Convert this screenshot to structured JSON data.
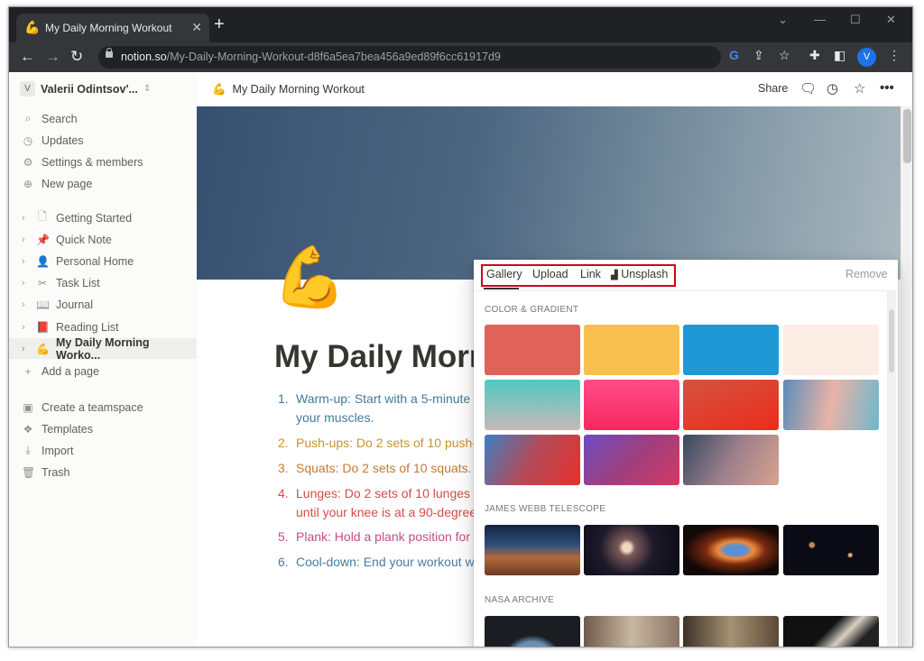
{
  "browser": {
    "tab_title": "My Daily Morning Workout",
    "url_domain": "notion.so",
    "url_path": "/My-Daily-Morning-Workout-d8f6a5ea7bea456a9ed89f6cc61917d9",
    "profile_initial": "V"
  },
  "sidebar": {
    "workspace_initial": "V",
    "workspace_name": "Valerii Odintsov'...",
    "top_items": [
      {
        "label": "Search",
        "icon": "search-icon"
      },
      {
        "label": "Updates",
        "icon": "clock-icon"
      },
      {
        "label": "Settings & members",
        "icon": "gear-icon"
      },
      {
        "label": "New page",
        "icon": "plus-circle-icon"
      }
    ],
    "pages": [
      {
        "label": "Getting Started",
        "icon": "page-icon"
      },
      {
        "label": "Quick Note",
        "icon": "pin-icon"
      },
      {
        "label": "Personal Home",
        "icon": "person-icon"
      },
      {
        "label": "Task List",
        "icon": "scissors-icon"
      },
      {
        "label": "Journal",
        "icon": "book-open-icon"
      },
      {
        "label": "Reading List",
        "icon": "book-icon"
      },
      {
        "label": "My Daily Morning Worko...",
        "icon": "flexed-biceps-icon",
        "selected": true
      }
    ],
    "add_page": "Add a page",
    "bottom_items": [
      {
        "label": "Create a teamspace",
        "icon": "teamspace-icon"
      },
      {
        "label": "Templates",
        "icon": "templates-icon"
      },
      {
        "label": "Import",
        "icon": "import-icon"
      },
      {
        "label": "Trash",
        "icon": "trash-icon"
      }
    ]
  },
  "topbar": {
    "breadcrumb": "My Daily Morning Workout",
    "share_label": "Share"
  },
  "page": {
    "icon": "💪",
    "title": "My Daily Morning Workout",
    "list": [
      {
        "num": "1.",
        "text": "Warm-up: Start with a 5-minute",
        "cont": "your muscles.",
        "color": "#447a97"
      },
      {
        "num": "2.",
        "text": "Push-ups: Do 2 sets of 10 push-",
        "color": "#cb912f"
      },
      {
        "num": "3.",
        "text": "Squats: Do 2 sets of 10 squats. K",
        "color": "#c47a30"
      },
      {
        "num": "4.",
        "text": "Lunges: Do 2 sets of 10 lunges o",
        "cont": "until your knee is at a 90-degree",
        "color": "#d44c47"
      },
      {
        "num": "5.",
        "text": "Plank: Hold a plank position for",
        "color": "#c14c8a"
      },
      {
        "num": "6.",
        "text": "Cool-down: End your workout w",
        "color": "#487ca5"
      }
    ]
  },
  "cover_popup": {
    "tabs": [
      "Gallery",
      "Upload",
      "Link",
      "Unsplash"
    ],
    "remove_label": "Remove",
    "sections": [
      "COLOR & GRADIENT",
      "JAMES WEBB TELESCOPE",
      "NASA ARCHIVE"
    ],
    "colors": [
      "#e16259",
      "#f7c04e",
      "#1f98d6",
      "#fbede4"
    ]
  }
}
